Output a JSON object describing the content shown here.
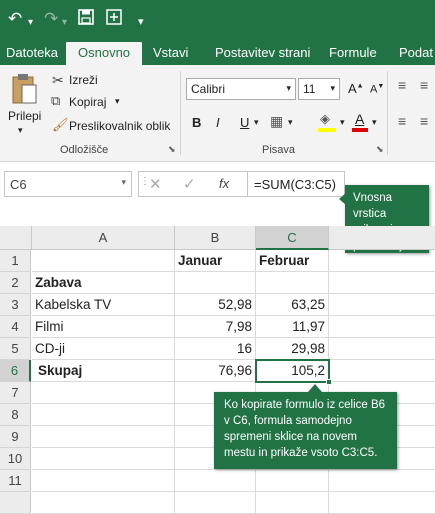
{
  "ribbon_tabs": [
    "Datoteka",
    "Osnovno",
    "Vstavi",
    "Postavitev strani",
    "Formule",
    "Podat"
  ],
  "clipboard": {
    "paste": "Prilepi",
    "cut": "Izreži",
    "copy": "Kopiraj",
    "format_painter": "Preslikovalnik oblik",
    "group": "Odložišče"
  },
  "font": {
    "name": "Calibri",
    "size": "11",
    "bold": "B",
    "italic": "I",
    "underline": "U",
    "color_letter": "A",
    "group": "Pisava"
  },
  "formula_bar": {
    "name_box": "C6",
    "formula": "=SUM(C3:C5)"
  },
  "callouts": {
    "formula_bar_note": "Vnosna vrstica prikazuje posodobljeno formulo.",
    "sheet_note": "Ko kopirate formulo iz celice B6 v C6, formula samodejno spremeni sklice na novem mestu in prikaže vsoto C3:C5."
  },
  "sheet": {
    "columns": [
      "A",
      "B",
      "C"
    ],
    "rows": [
      "1",
      "2",
      "3",
      "4",
      "5",
      "6",
      "7",
      "8",
      "9",
      "10",
      "11"
    ],
    "cells": {
      "B1": "Januar",
      "C1": "Februar",
      "A2": "Zabava",
      "A3": "Kabelska TV",
      "B3": "52,98",
      "C3": "63,25",
      "A4": "Filmi",
      "B4": "7,98",
      "C4": "11,97",
      "A5": "CD-ji",
      "B5": "16",
      "C5": "29,98",
      "A6": "Skupaj",
      "B6": "76,96",
      "C6": "105,2"
    },
    "selected_cell": "C6"
  },
  "colors": {
    "accent": "#217346",
    "selection": "#217346"
  }
}
